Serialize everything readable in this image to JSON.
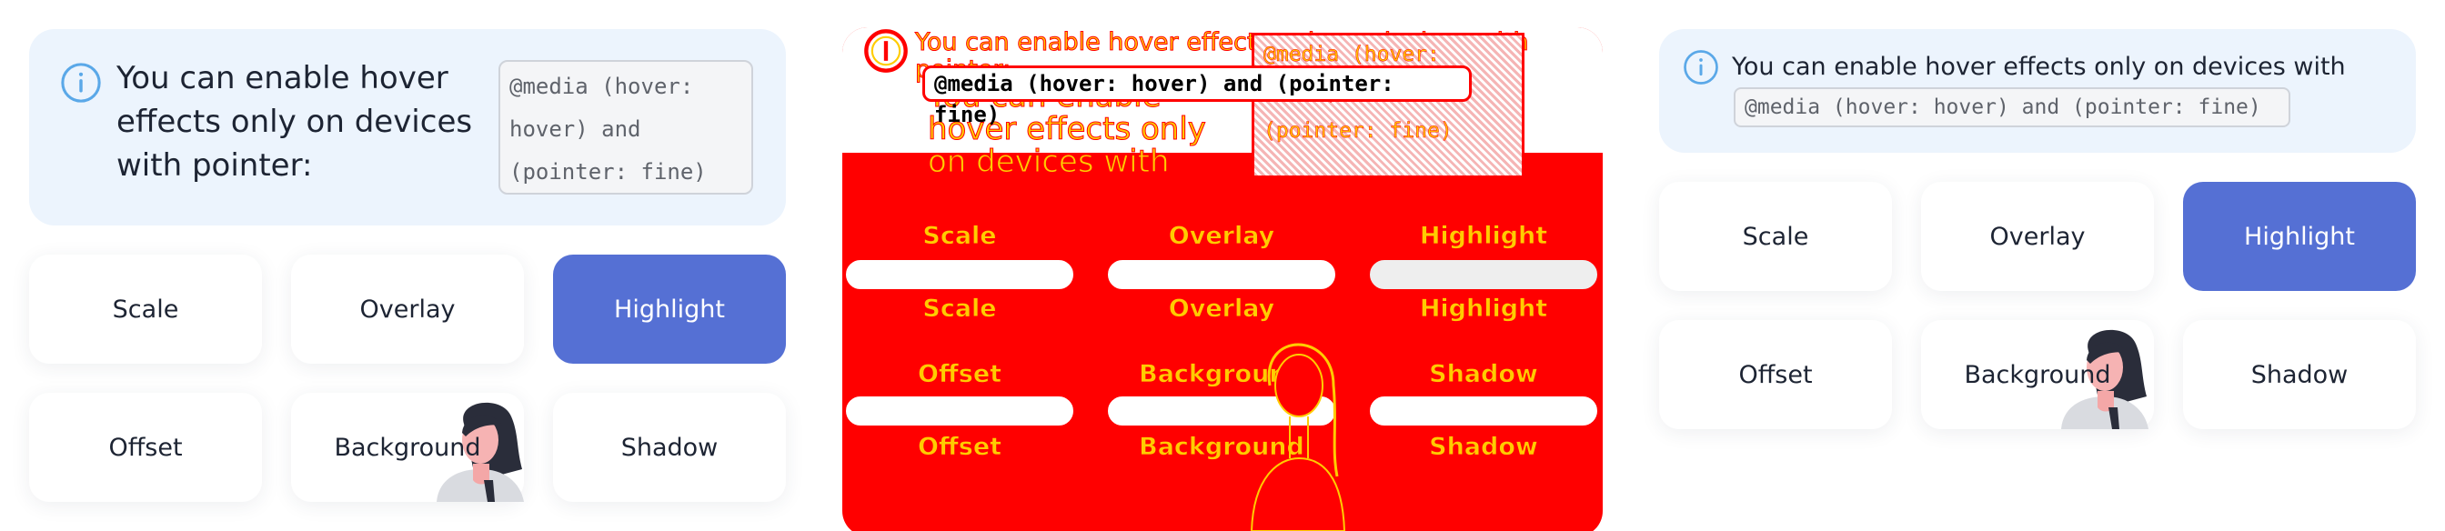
{
  "notice": {
    "text_wrapped": "You can enable hover effects only on devices with pointer:",
    "code": "@media (hover: hover) and (pointer: fine)",
    "code_wrapped": "@media (hover:\nhover) and\n(pointer: fine)"
  },
  "debug_view": {
    "ghost_text": "You can enable hover effects only on devices with pointer:",
    "code_right": "@media (hover:\nhover) and\n(pointer: fine)"
  },
  "buttons": [
    {
      "label": "Scale",
      "active": false
    },
    {
      "label": "Overlay",
      "active": false
    },
    {
      "label": "Highlight",
      "active": true
    },
    {
      "label": "Offset",
      "active": false
    },
    {
      "label": "Background",
      "active": false
    },
    {
      "label": "Shadow",
      "active": false
    }
  ],
  "colors": {
    "notice_bg": "#ecf4fd",
    "info_icon": "#5aa8e8",
    "active_button": "#5570d4",
    "text": "#1d2433",
    "debug_red": "#ff0000",
    "debug_yellow": "#ffcc00"
  },
  "icons": {
    "info": "info-circle-icon",
    "avatar": "woman-avatar-icon"
  }
}
